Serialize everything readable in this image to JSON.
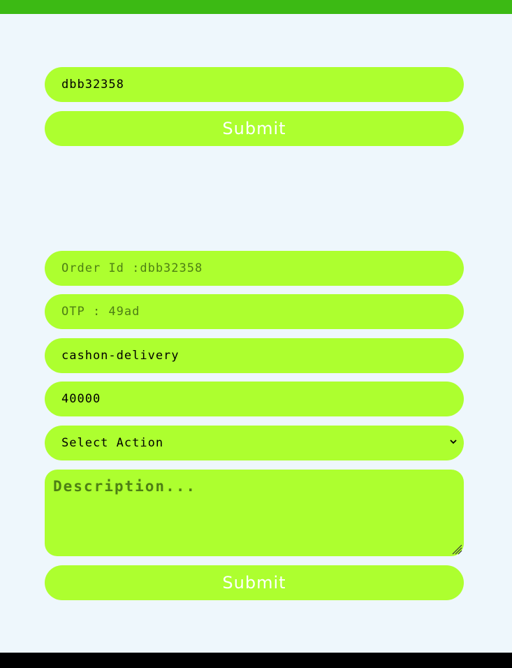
{
  "tracking_form": {
    "order_input_value": "dbb32358",
    "submit_label": "Submit"
  },
  "update_form": {
    "order_id_placeholder": "Order Id :dbb32358",
    "otp_placeholder": "OTP : 49ad",
    "payment_method_value": "cashon-delivery",
    "amount_value": "40000",
    "action_select_value": "Select Action",
    "description_placeholder": "Description...",
    "submit_label": "Submit"
  },
  "colors": {
    "top_bar": "#3cba14",
    "field_background": "#adff2f",
    "page_background": "#eef7fc",
    "bottom_bar": "#000000"
  }
}
